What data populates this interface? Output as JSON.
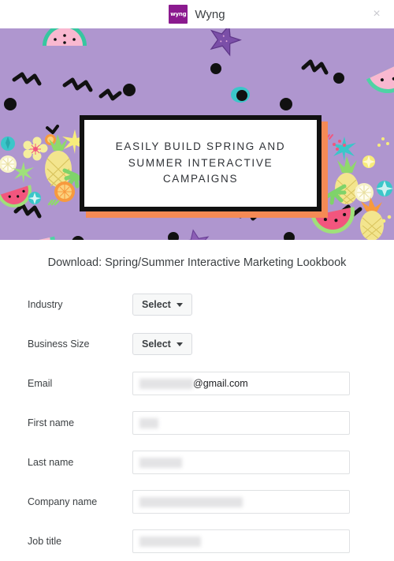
{
  "header": {
    "brand_logo_text": "wyng",
    "brand_name": "Wyng",
    "close_label": "×"
  },
  "banner": {
    "background_color": "#AF96CF",
    "accent_color": "#F58A55",
    "frame_color": "#111111",
    "hero_text": "EASILY BUILD SPRING AND SUMMER INTERACTIVE CAMPAIGNS"
  },
  "form": {
    "title": "Download: Spring/Summer Interactive Marketing Lookbook",
    "rows": [
      {
        "label": "Industry",
        "type": "select",
        "value": "Select"
      },
      {
        "label": "Business Size",
        "type": "select",
        "value": "Select"
      },
      {
        "label": "Email",
        "type": "text",
        "redacted_width": 68,
        "visible_value": "@gmail.com"
      },
      {
        "label": "First name",
        "type": "text",
        "redacted_width": 24,
        "visible_value": ""
      },
      {
        "label": "Last name",
        "type": "text",
        "redacted_width": 54,
        "visible_value": ""
      },
      {
        "label": "Company name",
        "type": "text",
        "redacted_width": 131,
        "visible_value": ""
      },
      {
        "label": "Job title",
        "type": "text",
        "redacted_width": 78,
        "visible_value": ""
      }
    ]
  }
}
